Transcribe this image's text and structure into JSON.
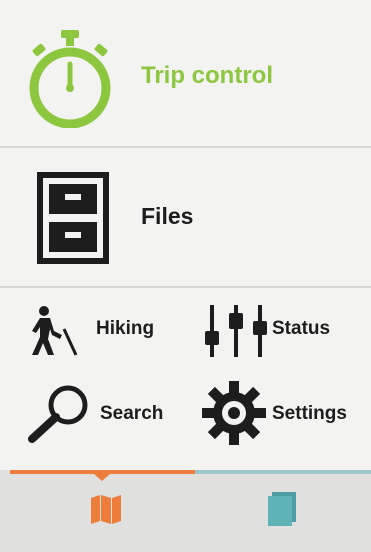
{
  "menu": {
    "trip_control": "Trip control",
    "files": "Files",
    "hiking": "Hiking",
    "status": "Status",
    "search": "Search",
    "settings": "Settings"
  },
  "icons": {
    "trip_control": "stopwatch-icon",
    "files": "file-cabinet-icon",
    "hiking": "hiker-icon",
    "status": "sliders-icon",
    "search": "magnifier-icon",
    "settings": "gear-icon",
    "tab_map": "map-icon",
    "tab_docs": "document-icon"
  },
  "colors": {
    "accent_green": "#8dc63f",
    "tab_map": "#ee7d3b",
    "tab_docs": "#5fb2b6",
    "text": "#1d1d1d"
  }
}
